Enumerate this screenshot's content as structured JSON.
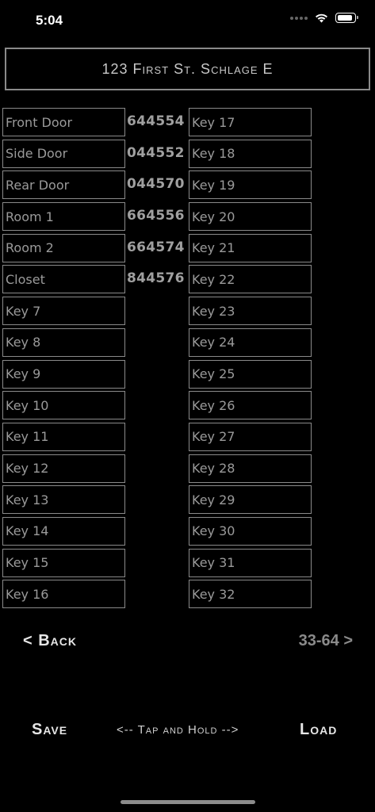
{
  "status_bar": {
    "time": "5:04"
  },
  "header": {
    "title": "123 First St. Schlage E"
  },
  "left_keys": [
    "Front Door",
    "Side Door",
    "Rear Door",
    "Room 1",
    "Room 2",
    "Closet",
    "Key 7",
    "Key 8",
    "Key 9",
    "Key 10",
    "Key 11",
    "Key 12",
    "Key 13",
    "Key 14",
    "Key 15",
    "Key 16"
  ],
  "codes": [
    "644554",
    "044552",
    "044570",
    "664556",
    "664574",
    "844576"
  ],
  "right_keys": [
    "Key 17",
    "Key 18",
    "Key 19",
    "Key 20",
    "Key 21",
    "Key 22",
    "Key 23",
    "Key 24",
    "Key 25",
    "Key 26",
    "Key 27",
    "Key 28",
    "Key 29",
    "Key 30",
    "Key 31",
    "Key 32"
  ],
  "nav": {
    "back_label": "< Back",
    "next_label": "33-64 >"
  },
  "footer": {
    "save_label": "Save",
    "hint": "<-- Tap and Hold -->",
    "load_label": "Load"
  },
  "colors": {
    "background": "#000000",
    "border": "#8a8a8a",
    "text": "#9a9a9a"
  }
}
